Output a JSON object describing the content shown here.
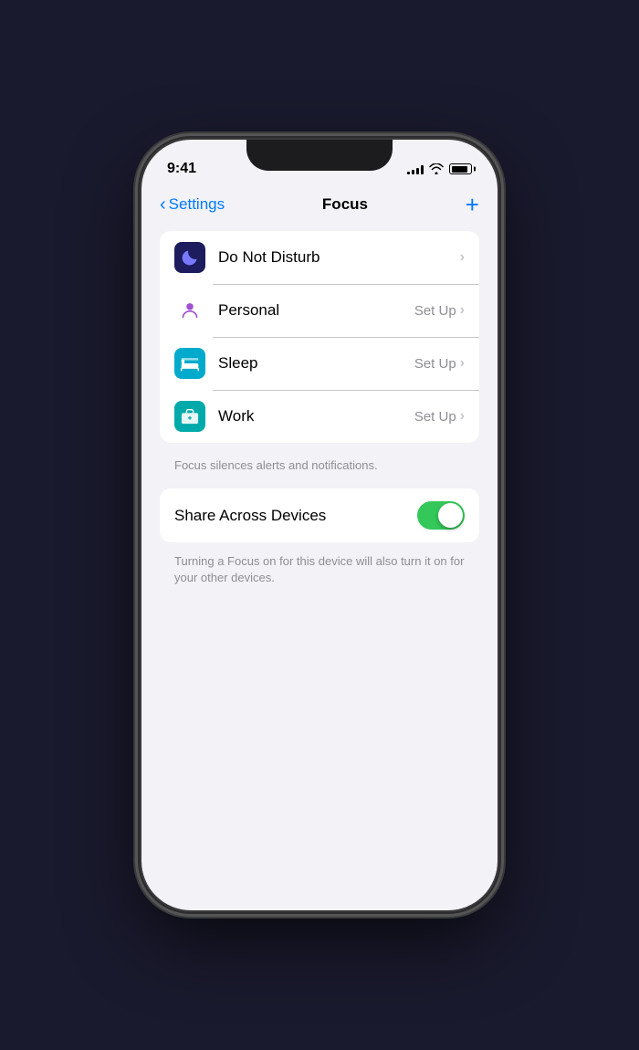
{
  "statusBar": {
    "time": "9:41",
    "signalBars": [
      3,
      5,
      7,
      10,
      12
    ],
    "batteryLevel": 85
  },
  "header": {
    "backLabel": "Settings",
    "title": "Focus",
    "addLabel": "+"
  },
  "focusItems": [
    {
      "id": "do-not-disturb",
      "label": "Do Not Disturb",
      "iconType": "dnd",
      "setup": "",
      "showSetUp": false
    },
    {
      "id": "personal",
      "label": "Personal",
      "iconType": "personal",
      "setup": "Set Up",
      "showSetUp": true
    },
    {
      "id": "sleep",
      "label": "Sleep",
      "iconType": "sleep",
      "setup": "Set Up",
      "showSetUp": true
    },
    {
      "id": "work",
      "label": "Work",
      "iconType": "work",
      "setup": "Set Up",
      "showSetUp": true
    }
  ],
  "listCaption": "Focus silences alerts and notifications.",
  "shareAcrossDevices": {
    "label": "Share Across Devices",
    "enabled": true
  },
  "toggleCaption": "Turning a Focus on for this device will also turn it on for your other devices.",
  "colors": {
    "accent": "#007aff",
    "toggleOn": "#34c759"
  }
}
